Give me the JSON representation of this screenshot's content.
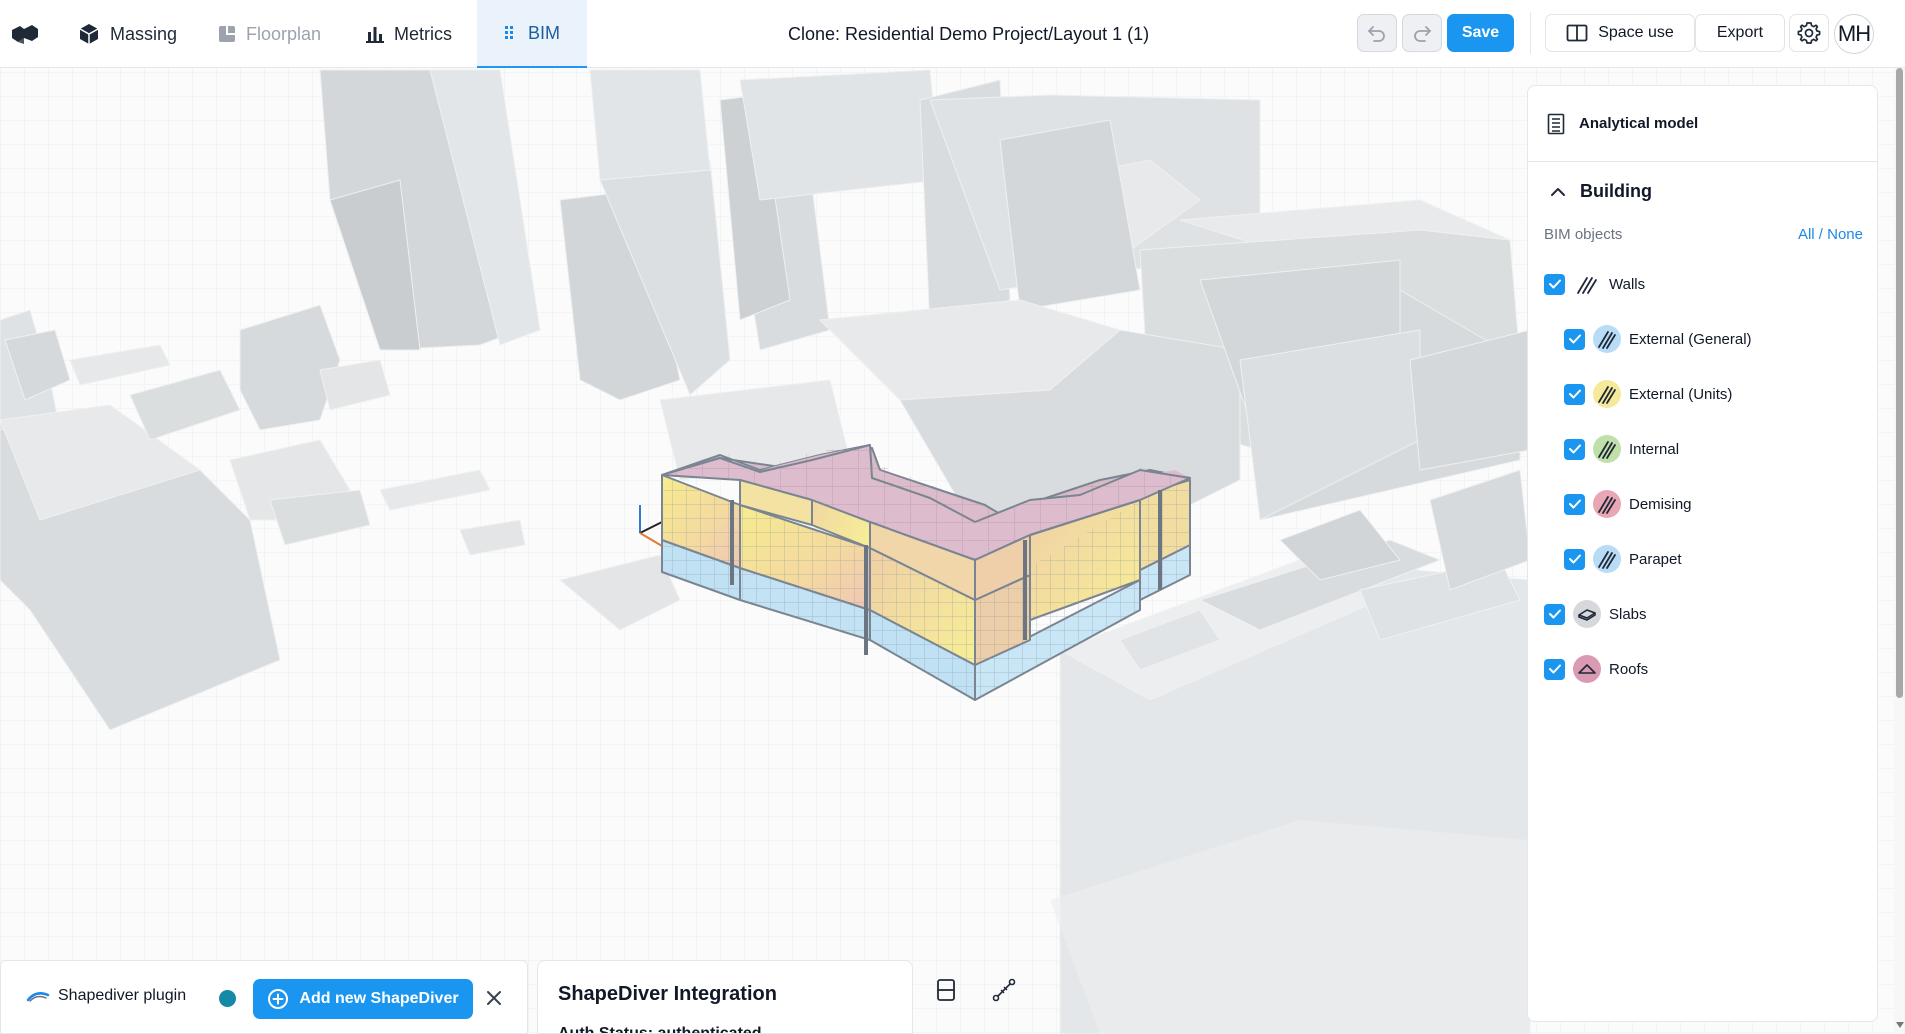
{
  "toolbar": {
    "tabs": [
      {
        "label": "Massing",
        "icon": "cube-icon"
      },
      {
        "label": "Floorplan",
        "icon": "floorplan-icon"
      },
      {
        "label": "Metrics",
        "icon": "bar-chart-icon"
      },
      {
        "label": "BIM",
        "icon": "bim-icon"
      }
    ],
    "title": "Clone: Residential Demo Project/Layout 1 (1)",
    "save_label": "Save",
    "space_use_label": "Space use",
    "export_label": "Export",
    "avatar_initials": "MH"
  },
  "panel": {
    "header_label": "Analytical model",
    "section_title": "Building",
    "bim_objects_label": "BIM objects",
    "all_none_label": "All / None",
    "items": [
      {
        "label": "Walls",
        "checked": true,
        "level": 0,
        "icon": "walls-icon",
        "color": "#ffffff"
      },
      {
        "label": "External (General)",
        "checked": true,
        "level": 1,
        "icon": "wall-hatch-icon",
        "color": "#b8dcf5"
      },
      {
        "label": "External (Units)",
        "checked": true,
        "level": 1,
        "icon": "wall-hatch-icon",
        "color": "#f5e99a"
      },
      {
        "label": "Internal",
        "checked": true,
        "level": 1,
        "icon": "wall-hatch-icon",
        "color": "#bfe0a8"
      },
      {
        "label": "Demising",
        "checked": true,
        "level": 1,
        "icon": "wall-hatch-icon",
        "color": "#e9a6b4"
      },
      {
        "label": "Parapet",
        "checked": true,
        "level": 1,
        "icon": "wall-hatch-icon",
        "color": "#b8dcf5"
      },
      {
        "label": "Slabs",
        "checked": true,
        "level": 0,
        "icon": "slab-icon",
        "color": "#d6d8db"
      },
      {
        "label": "Roofs",
        "checked": true,
        "level": 0,
        "icon": "roof-icon",
        "color": "#d99ab2"
      }
    ]
  },
  "plugin": {
    "name": "Shapediver plugin",
    "add_label": "Add new ShapeDiver",
    "status_color": "#148aa6"
  },
  "shapediver": {
    "title": "ShapeDiver Integration",
    "status_text": "Auth Status:  authenticated"
  },
  "colors": {
    "accent": "#1a96f0",
    "context_building": "#dcdfe1"
  }
}
